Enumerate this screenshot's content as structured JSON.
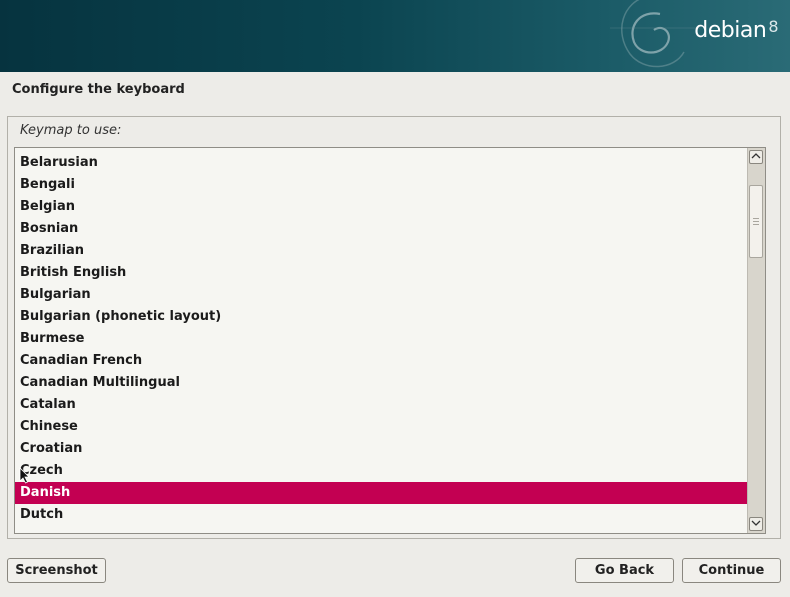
{
  "header": {
    "brand": "debian",
    "version": "8"
  },
  "page_title": "Configure the keyboard",
  "keymap": {
    "label": "Keymap to use:",
    "items": [
      "Belarusian",
      "Bengali",
      "Belgian",
      "Bosnian",
      "Brazilian",
      "British English",
      "Bulgarian",
      "Bulgarian (phonetic layout)",
      "Burmese",
      "Canadian French",
      "Canadian Multilingual",
      "Catalan",
      "Chinese",
      "Croatian",
      "Czech",
      "Danish",
      "Dutch"
    ],
    "selected": "Danish",
    "selected_color": "#c30052"
  },
  "buttons": {
    "screenshot": "Screenshot",
    "go_back": "Go Back",
    "continue": "Continue"
  },
  "icons": {
    "scroll_up": "up-arrow-icon",
    "scroll_down": "down-arrow-icon",
    "logo": "debian-swirl-icon",
    "cursor": "mouse-pointer-icon"
  }
}
